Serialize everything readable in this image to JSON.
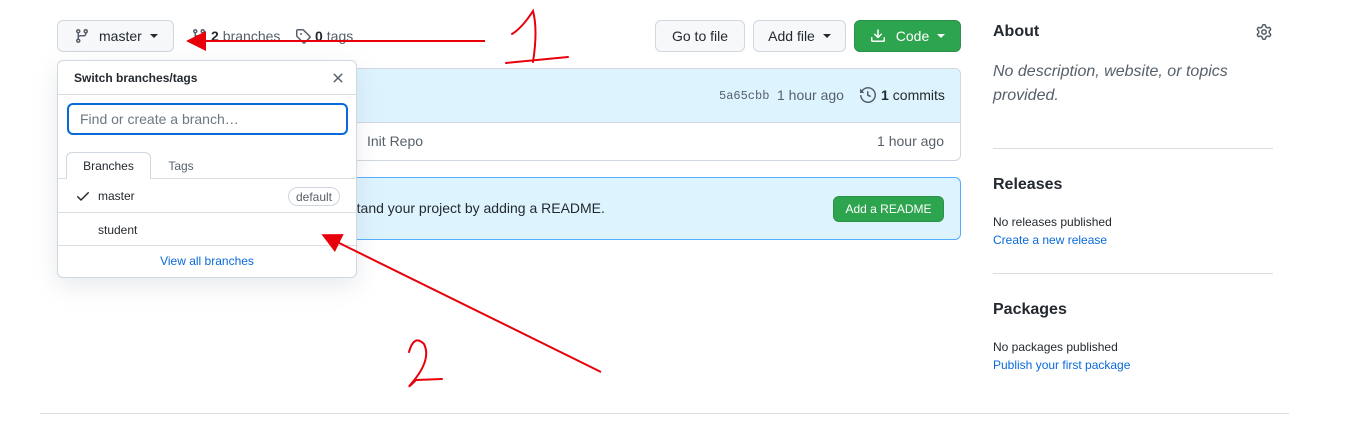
{
  "repo_header": {
    "branch_button_label": "master",
    "branches_count": "2",
    "branches_label": "branches",
    "tags_count": "0",
    "tags_label": "tags",
    "goto_file_label": "Go to file",
    "add_file_label": "Add file",
    "code_label": "Code"
  },
  "commit_box": {
    "sha": "5a65cbb",
    "time": "1 hour ago",
    "commits_count": "1",
    "commits_label": "commits",
    "file_message": "Init Repo",
    "file_time": "1 hour ago"
  },
  "readme_banner": {
    "text": "rstand your project by adding a README.",
    "button_label": "Add a README"
  },
  "branch_dropdown": {
    "title": "Switch branches/tags",
    "search_placeholder": "Find or create a branch…",
    "tabs": [
      {
        "label": "Branches",
        "active": true
      },
      {
        "label": "Tags",
        "active": false
      }
    ],
    "branches": [
      {
        "name": "master",
        "selected": true,
        "badge": "default"
      },
      {
        "name": "student",
        "selected": false,
        "badge": ""
      }
    ],
    "view_all_label": "View all branches"
  },
  "sidebar": {
    "about_heading": "About",
    "about_description": "No description, website, or topics provided.",
    "releases_heading": "Releases",
    "releases_text": "No releases published",
    "releases_link": "Create a new release",
    "packages_heading": "Packages",
    "packages_text": "No packages published",
    "packages_link": "Publish your first package"
  },
  "annotations": {
    "label_1": "1",
    "label_2": "2"
  },
  "colors": {
    "primary_green": "#2da44e",
    "link_blue": "#0969da",
    "banner_blue": "#ddf4ff",
    "annotation_red": "#e8000b"
  }
}
